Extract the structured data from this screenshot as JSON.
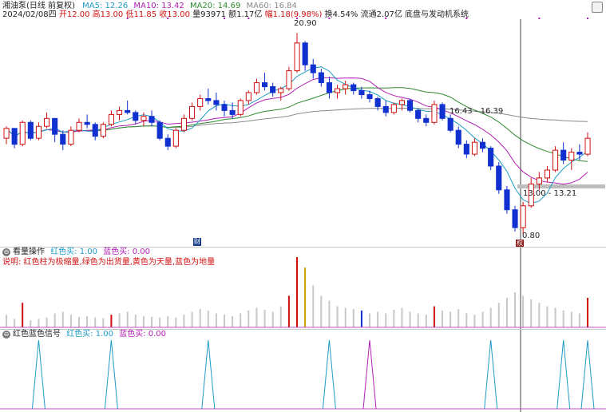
{
  "header": {
    "title": "湘油泵(日线 前复权)",
    "ma5": "MA5: 12.26",
    "ma10": "MA10: 13.42",
    "ma20": "MA20: 14.69",
    "ma60": "MA60: 16.84",
    "colors": {
      "ma5": "#1f9bc6",
      "ma10": "#b01fb5",
      "ma20": "#2f8a2f",
      "ma60": "#8a8a8a"
    }
  },
  "info_bar": {
    "date": "2024/02/08四",
    "open": "开12.00",
    "high": "高13.00",
    "low": "低11.85",
    "close": "收13.00",
    "volume": "量93971",
    "amount": "额1.17亿",
    "change": "幅1.18(9.98%)",
    "turnover": "换4.54%",
    "float": "流通2.07亿",
    "indicator": "底盘与发动机系统"
  },
  "annotations": {
    "high_price": "20.90",
    "range_upper": "16.43 - 16.39",
    "range_lower": "13.00 - 13.21",
    "low_price": "0.80",
    "marker_a": "财",
    "marker_b": "权"
  },
  "volume_panel": {
    "title": "看量操作",
    "red_buy": "红色买: 1.00",
    "blue_buy": "蓝色买: 0.00",
    "note": "说明: 红色柱为极缩量,绿色为出货量,黄色为天量,蓝色为地量"
  },
  "signal_panel": {
    "title": "红色蓝色信号",
    "red_buy": "红色买: 1.00",
    "blue_buy": "蓝色买: 0.00"
  },
  "chart_data": {
    "type": "candlestick",
    "candles": [
      [
        15.6,
        16.2,
        15.3,
        16.1
      ],
      [
        16.1,
        16.1,
        15.1,
        15.3
      ],
      [
        15.3,
        16.5,
        15.2,
        16.4
      ],
      [
        16.4,
        16.5,
        15.5,
        15.6
      ],
      [
        15.6,
        16.4,
        15.5,
        16.2
      ],
      [
        16.2,
        16.9,
        16.1,
        16.6
      ],
      [
        16.6,
        16.6,
        15.4,
        15.8
      ],
      [
        15.8,
        16.0,
        15.0,
        15.3
      ],
      [
        15.3,
        16.2,
        15.2,
        16.0
      ],
      [
        16.0,
        16.6,
        15.9,
        16.4
      ],
      [
        16.4,
        16.8,
        16.1,
        16.3
      ],
      [
        16.3,
        16.4,
        15.5,
        15.7
      ],
      [
        15.7,
        16.4,
        15.6,
        16.3
      ],
      [
        16.3,
        17.0,
        16.2,
        16.8
      ],
      [
        16.8,
        17.2,
        16.5,
        17.0
      ],
      [
        17.0,
        17.5,
        16.8,
        16.9
      ],
      [
        16.9,
        17.0,
        16.3,
        16.5
      ],
      [
        16.5,
        16.9,
        16.2,
        16.7
      ],
      [
        16.7,
        17.0,
        16.2,
        16.4
      ],
      [
        16.4,
        16.5,
        15.5,
        15.6
      ],
      [
        15.6,
        15.8,
        15.0,
        15.2
      ],
      [
        15.2,
        16.1,
        15.1,
        16.0
      ],
      [
        16.0,
        16.8,
        15.9,
        16.6
      ],
      [
        16.6,
        17.4,
        16.5,
        17.2
      ],
      [
        17.2,
        17.8,
        17.0,
        17.6
      ],
      [
        17.6,
        18.1,
        17.3,
        17.5
      ],
      [
        17.5,
        17.9,
        17.0,
        17.3
      ],
      [
        17.3,
        17.5,
        16.7,
        17.0
      ],
      [
        17.0,
        17.4,
        16.6,
        16.8
      ],
      [
        16.8,
        17.6,
        16.7,
        17.5
      ],
      [
        17.5,
        18.0,
        17.3,
        17.9
      ],
      [
        17.9,
        18.6,
        17.8,
        18.4
      ],
      [
        18.4,
        18.9,
        18.0,
        18.2
      ],
      [
        18.2,
        18.4,
        17.7,
        17.9
      ],
      [
        17.9,
        18.2,
        17.5,
        18.1
      ],
      [
        18.1,
        19.2,
        18.0,
        19.0
      ],
      [
        19.0,
        20.9,
        18.9,
        20.4
      ],
      [
        20.4,
        20.5,
        19.0,
        19.3
      ],
      [
        19.3,
        19.6,
        18.6,
        18.9
      ],
      [
        18.9,
        19.1,
        18.2,
        18.4
      ],
      [
        18.4,
        18.7,
        17.6,
        17.9
      ],
      [
        17.9,
        18.3,
        17.6,
        18.1
      ],
      [
        18.1,
        18.5,
        17.8,
        18.3
      ],
      [
        18.3,
        18.4,
        17.8,
        18.0
      ],
      [
        18.0,
        18.2,
        17.6,
        17.8
      ],
      [
        17.8,
        18.0,
        17.4,
        17.6
      ],
      [
        17.6,
        17.7,
        17.0,
        17.2
      ],
      [
        17.2,
        17.5,
        16.7,
        16.9
      ],
      [
        16.9,
        17.4,
        16.8,
        17.3
      ],
      [
        17.3,
        17.6,
        17.0,
        17.5
      ],
      [
        17.5,
        17.6,
        16.9,
        17.0
      ],
      [
        17.0,
        17.1,
        16.4,
        16.6
      ],
      [
        16.6,
        16.8,
        16.2,
        16.4
      ],
      [
        16.4,
        17.5,
        16.3,
        17.3
      ],
      [
        17.3,
        17.4,
        16.5,
        16.6
      ],
      [
        16.6,
        16.8,
        15.9,
        16.0
      ],
      [
        16.0,
        16.2,
        15.1,
        15.3
      ],
      [
        15.3,
        15.5,
        14.6,
        14.8
      ],
      [
        14.8,
        15.6,
        14.7,
        15.4
      ],
      [
        15.4,
        15.6,
        14.9,
        15.1
      ],
      [
        15.1,
        15.2,
        14.0,
        14.2
      ],
      [
        14.2,
        14.4,
        12.8,
        13.0
      ],
      [
        13.0,
        13.2,
        11.8,
        12.0
      ],
      [
        12.0,
        12.2,
        10.9,
        11.1
      ],
      [
        11.1,
        12.4,
        10.8,
        12.2
      ],
      [
        12.2,
        13.6,
        12.1,
        13.3
      ],
      [
        13.3,
        13.9,
        13.0,
        13.6
      ],
      [
        13.6,
        14.2,
        13.4,
        14.0
      ],
      [
        14.0,
        15.2,
        13.9,
        15.0
      ],
      [
        15.0,
        15.4,
        14.3,
        14.5
      ],
      [
        14.5,
        15.1,
        14.0,
        14.9
      ],
      [
        14.9,
        15.3,
        14.5,
        14.8
      ],
      [
        14.8,
        15.9,
        14.7,
        15.6
      ]
    ],
    "volume": [
      0.18,
      0.12,
      0.35,
      0.1,
      0.12,
      0.14,
      0.2,
      0.22,
      0.18,
      0.15,
      0.16,
      0.14,
      0.13,
      0.18,
      0.2,
      0.22,
      0.18,
      0.16,
      0.15,
      0.14,
      0.16,
      0.14,
      0.18,
      0.22,
      0.26,
      0.24,
      0.2,
      0.18,
      0.16,
      0.2,
      0.24,
      0.28,
      0.25,
      0.22,
      0.3,
      0.45,
      1.0,
      0.85,
      0.6,
      0.45,
      0.38,
      0.3,
      0.28,
      0.26,
      0.24,
      0.2,
      0.22,
      0.2,
      0.25,
      0.28,
      0.22,
      0.2,
      0.18,
      0.3,
      0.24,
      0.22,
      0.26,
      0.2,
      0.18,
      0.22,
      0.28,
      0.35,
      0.42,
      0.5,
      0.45,
      0.4,
      0.35,
      0.3,
      0.28,
      0.24,
      0.22,
      0.2,
      0.42
    ],
    "volume_colors": {
      "red": [
        2,
        13,
        35,
        36,
        53,
        72
      ],
      "yellow": [
        37
      ],
      "blue": [
        44
      ]
    },
    "signals_teal": [
      4,
      13,
      25,
      40,
      60,
      69,
      72
    ],
    "signals_purple": [
      45
    ],
    "price_range": [
      10.5,
      21.6
    ]
  }
}
